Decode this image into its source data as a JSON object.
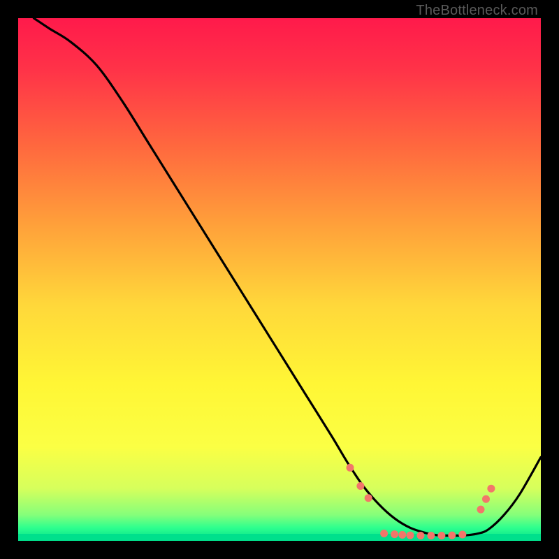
{
  "watermark": "TheBottleneck.com",
  "chart_data": {
    "type": "line",
    "title": "",
    "xlabel": "",
    "ylabel": "",
    "xlim": [
      0,
      100
    ],
    "ylim": [
      0,
      100
    ],
    "grid": false,
    "legend": false,
    "gradient_stops": [
      {
        "offset": 0.0,
        "color": "#ff1a4b"
      },
      {
        "offset": 0.1,
        "color": "#ff3348"
      },
      {
        "offset": 0.25,
        "color": "#ff6a3e"
      },
      {
        "offset": 0.4,
        "color": "#ffa23a"
      },
      {
        "offset": 0.55,
        "color": "#ffd83a"
      },
      {
        "offset": 0.7,
        "color": "#fff635"
      },
      {
        "offset": 0.82,
        "color": "#fbff44"
      },
      {
        "offset": 0.9,
        "color": "#d6ff5c"
      },
      {
        "offset": 0.95,
        "color": "#86ff7a"
      },
      {
        "offset": 0.975,
        "color": "#2eff8e"
      },
      {
        "offset": 1.0,
        "color": "#00e08c"
      }
    ],
    "curve": {
      "name": "bottleneck-curve",
      "x": [
        3,
        6,
        10,
        15,
        20,
        25,
        30,
        35,
        40,
        45,
        50,
        55,
        60,
        63,
        66,
        69,
        72,
        75,
        78,
        80,
        82,
        84,
        86,
        88,
        90,
        93,
        96,
        100
      ],
      "y": [
        100,
        98,
        95.5,
        91,
        84,
        76,
        68,
        60,
        52,
        44,
        36,
        28,
        20,
        15,
        10.5,
        7,
        4.3,
        2.5,
        1.5,
        1.1,
        1.0,
        1.0,
        1.1,
        1.4,
        2.2,
        5,
        9,
        16
      ]
    },
    "markers": {
      "name": "highlight-dots",
      "color": "#f2766a",
      "radius_px": 5.5,
      "points": [
        {
          "x": 63.5,
          "y": 14.0
        },
        {
          "x": 65.5,
          "y": 10.5
        },
        {
          "x": 67.0,
          "y": 8.2
        },
        {
          "x": 70.0,
          "y": 1.4
        },
        {
          "x": 72.0,
          "y": 1.25
        },
        {
          "x": 73.5,
          "y": 1.15
        },
        {
          "x": 75.0,
          "y": 1.05
        },
        {
          "x": 77.0,
          "y": 1.0
        },
        {
          "x": 79.0,
          "y": 1.0
        },
        {
          "x": 81.0,
          "y": 1.0
        },
        {
          "x": 83.0,
          "y": 1.05
        },
        {
          "x": 85.0,
          "y": 1.2
        },
        {
          "x": 88.5,
          "y": 6.0
        },
        {
          "x": 89.5,
          "y": 8.0
        },
        {
          "x": 90.5,
          "y": 10.0
        }
      ]
    }
  }
}
